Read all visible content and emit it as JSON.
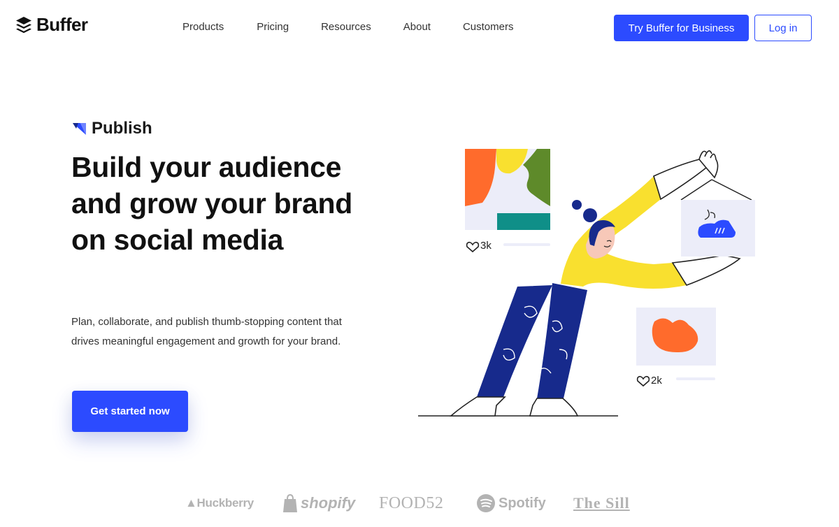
{
  "header": {
    "logo_text": "Buffer",
    "nav": [
      {
        "label": "Products"
      },
      {
        "label": "Pricing"
      },
      {
        "label": "Resources"
      },
      {
        "label": "About"
      },
      {
        "label": "Customers"
      }
    ],
    "cta_business": "Try Buffer for Business",
    "login": "Log in"
  },
  "hero": {
    "product_label": "Publish",
    "headline": "Build your audience and grow your brand on social media",
    "subtext": "Plan, collaborate, and publish thumb-stopping content that drives meaningful engagement and growth for your brand.",
    "cta": "Get started now"
  },
  "illustration": {
    "likes_top": "3k",
    "likes_bottom": "2k"
  },
  "customers": [
    {
      "name": "Huckberry"
    },
    {
      "name": "shopify"
    },
    {
      "name": "FOOD52"
    },
    {
      "name": "Spotify"
    },
    {
      "name": "The Sill"
    }
  ],
  "colors": {
    "brand_blue": "#2c4bff",
    "yellow": "#f9e02f",
    "navy": "#172a8c",
    "orange": "#ff6b2c",
    "teal": "#0f8f88",
    "lavender": "#ecedf9"
  }
}
